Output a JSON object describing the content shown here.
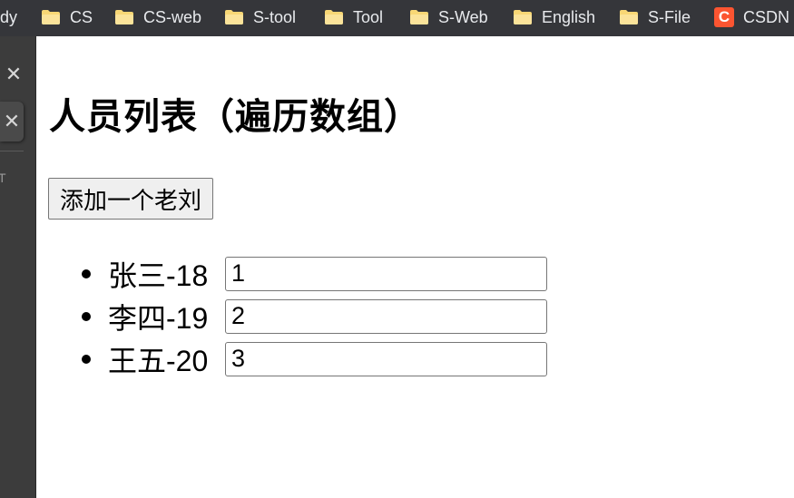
{
  "bookmarks": {
    "lead_text": "dy",
    "items": [
      {
        "label": "CS",
        "icon": "folder-icon"
      },
      {
        "label": "CS-web",
        "icon": "folder-icon"
      },
      {
        "label": "S-tool",
        "icon": "folder-icon"
      },
      {
        "label": "Tool",
        "icon": "folder-icon"
      },
      {
        "label": "S-Web",
        "icon": "folder-icon"
      },
      {
        "label": "English",
        "icon": "folder-icon"
      },
      {
        "label": "S-File",
        "icon": "folder-icon"
      },
      {
        "label": "CSDN",
        "icon": "csdn-icon",
        "icon_text": "C"
      }
    ]
  },
  "side": {
    "btn1_glyph": "✕",
    "btn2_glyph": "✕",
    "letter": "T"
  },
  "page": {
    "title": "人员列表（遍历数组）",
    "add_button_label": "添加一个老刘",
    "persons": [
      {
        "label": "张三-18",
        "input_value": "1"
      },
      {
        "label": "李四-19",
        "input_value": "2"
      },
      {
        "label": "王五-20",
        "input_value": "3"
      }
    ]
  },
  "colors": {
    "bookmark_bar_bg": "#35363a",
    "side_panel_bg": "#3c3c3c",
    "folder_yellow": "#f8d775",
    "csdn_red": "#fc5531"
  }
}
